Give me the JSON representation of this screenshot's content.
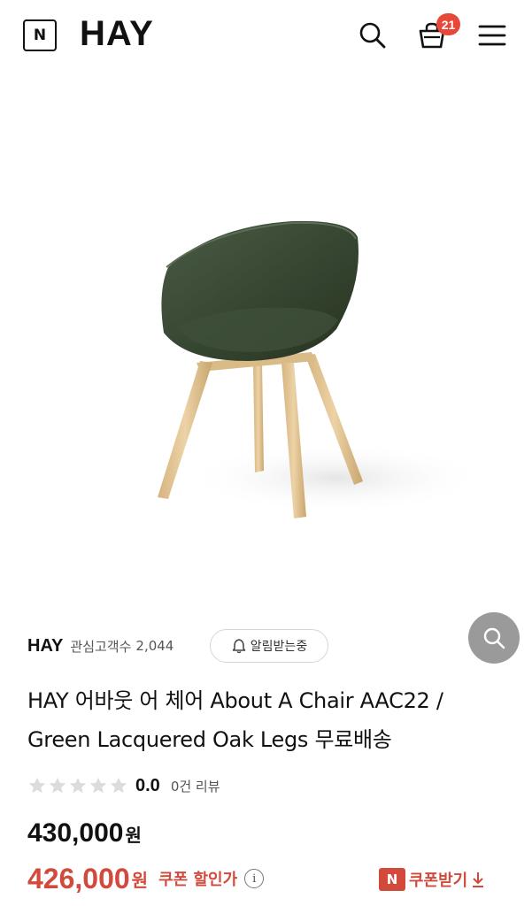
{
  "header": {
    "n_logo": "N",
    "brand_logo": "HAY",
    "cart_count": "21",
    "icons": [
      "n-logo-icon",
      "search-icon",
      "cart-icon",
      "menu-icon"
    ]
  },
  "product": {
    "image_alt": "green plastic chair with oak legs",
    "brand": "HAY",
    "fan_label": "관심고객수",
    "fan_count": "2,044",
    "alarm_label": "알림받는중",
    "title": "HAY 어바웃 어 체어 About A Chair AAC22 / Green Lacquered Oak Legs 무료배송",
    "rating": {
      "value": "0.0",
      "stars_filled": 0,
      "stars_total": 5,
      "review_count": "0건 리뷰"
    },
    "price": {
      "original": "430,000",
      "unit": "원",
      "sale": "426,000",
      "coupon_discount_label": "쿠폰 할인가",
      "coupon_get_label": "쿠폰받기",
      "n_badge": "N"
    }
  },
  "colors": {
    "accent": "#d24a3c",
    "badge": "#e8483a",
    "chair_shell": "#3d4d38",
    "chair_legs": "#e2c495",
    "zoom_button": "#9a9a9a"
  }
}
